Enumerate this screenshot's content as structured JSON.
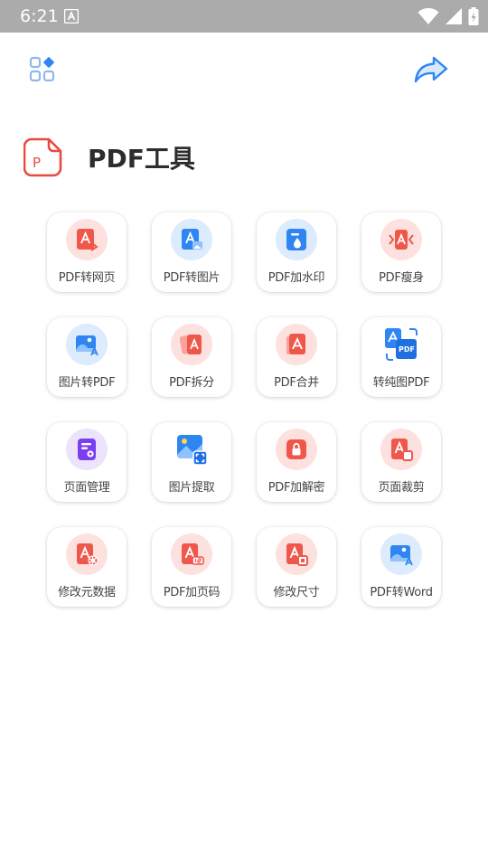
{
  "status_bar": {
    "time": "6:21"
  },
  "header": {
    "title": "PDF工具",
    "logo_letter": "P"
  },
  "colors": {
    "accent_red": "#f0574b",
    "accent_blue": "#2f86f3",
    "accent_purple": "#7b3ff2",
    "title_text": "#2d2d2d"
  },
  "tools": [
    {
      "label": "PDF转网页",
      "icon": "pdf-to-web-icon"
    },
    {
      "label": "PDF转图片",
      "icon": "pdf-to-image-icon"
    },
    {
      "label": "PDF加水印",
      "icon": "watermark-drop-icon"
    },
    {
      "label": "PDF瘦身",
      "icon": "compress-icon"
    },
    {
      "label": "图片转PDF",
      "icon": "image-to-pdf-icon"
    },
    {
      "label": "PDF拆分",
      "icon": "split-icon"
    },
    {
      "label": "PDF合并",
      "icon": "merge-icon"
    },
    {
      "label": "转纯图PDF",
      "icon": "pure-image-pdf-icon"
    },
    {
      "label": "页面管理",
      "icon": "page-manage-icon"
    },
    {
      "label": "图片提取",
      "icon": "image-extract-icon"
    },
    {
      "label": "PDF加解密",
      "icon": "lock-icon"
    },
    {
      "label": "页面裁剪",
      "icon": "crop-icon"
    },
    {
      "label": "修改元数据",
      "icon": "metadata-gear-icon"
    },
    {
      "label": "PDF加页码",
      "icon": "page-number-icon"
    },
    {
      "label": "修改尺寸",
      "icon": "resize-icon"
    },
    {
      "label": "PDF转Word",
      "icon": "pdf-to-word-icon"
    }
  ]
}
